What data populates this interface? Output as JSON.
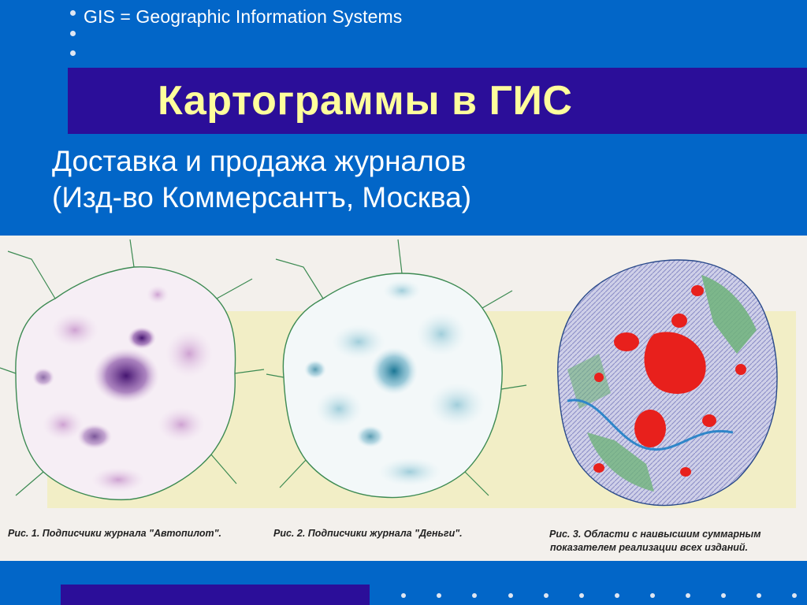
{
  "header": {
    "text": "GIS = Geographic Information Systems"
  },
  "slide": {
    "title": "Картограммы в ГИС",
    "subtitle_line1": "Доставка и продажа журналов",
    "subtitle_line2": "(Изд-во Коммерсантъ, Москва)"
  },
  "figures": [
    {
      "caption_line1": "Рис. 1.  Подписчики журнала \"Автопилот\".",
      "caption_line2": ""
    },
    {
      "caption_line1": "Рис. 2.  Подписчики журнала \"Деньги\".",
      "caption_line2": ""
    },
    {
      "caption_line1": "Рис. 3.  Области с наивысшим суммарным",
      "caption_line2": "показателем реализации всех изданий."
    }
  ],
  "colors": {
    "background": "#0266c8",
    "title_band": "#2b0e99",
    "title_text": "#fefe9c",
    "map1_density": "#5a1a78",
    "map2_density": "#1f8fa8",
    "map3_hot": "#e8201c"
  }
}
